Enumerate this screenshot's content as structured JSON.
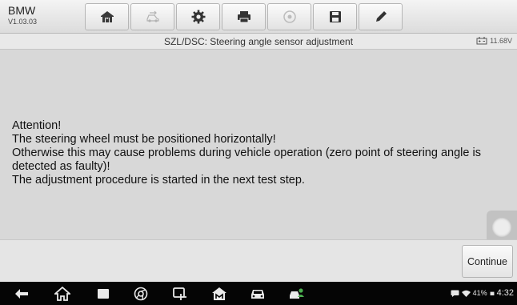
{
  "header": {
    "make": "BMW",
    "version": "V1.03.03",
    "toolbar": [
      {
        "id": "home",
        "icon": "home-icon"
      },
      {
        "id": "vehicle-swap",
        "icon": "vehicle-swap-icon"
      },
      {
        "id": "settings",
        "icon": "gear-icon"
      },
      {
        "id": "print",
        "icon": "printer-icon"
      },
      {
        "id": "help",
        "icon": "help-icon"
      },
      {
        "id": "save",
        "icon": "save-icon"
      },
      {
        "id": "edit",
        "icon": "pencil-icon"
      }
    ]
  },
  "titlebar": {
    "title": "SZL/DSC: Steering angle sensor adjustment",
    "battery_voltage": "11.68V"
  },
  "message": {
    "lines": [
      "Attention!",
      "The steering wheel must be positioned horizontally!",
      "Otherwise this may cause problems during vehicle operation (zero point of steering angle is detected as faulty)!",
      "The adjustment procedure is started in the next test step."
    ]
  },
  "actions": {
    "continue_label": "Continue"
  },
  "navbar": {
    "items": [
      "back-icon",
      "home-icon",
      "recent-apps-icon",
      "chrome-icon",
      "vci-icon",
      "maxisys-home-icon",
      "car-icon",
      "car-user-icon"
    ],
    "battery_percent": "41%",
    "time": "4:32"
  },
  "colors": {
    "background": "#d8d8d8",
    "toolbar": "#e6e6e6",
    "navbar": "#050505"
  }
}
